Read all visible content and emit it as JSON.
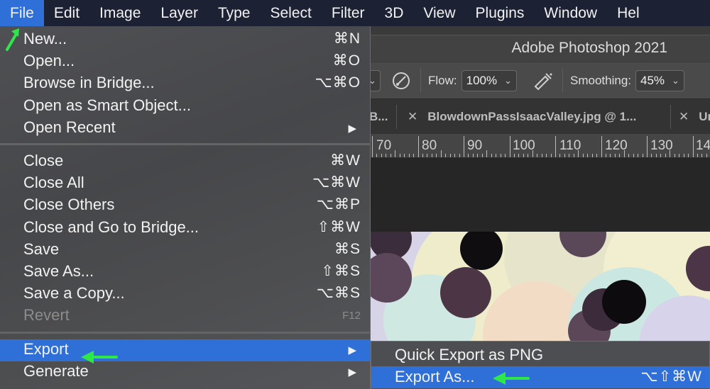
{
  "menubar": {
    "items": [
      "File",
      "Edit",
      "Image",
      "Layer",
      "Type",
      "Select",
      "Filter",
      "3D",
      "View",
      "Plugins",
      "Window",
      "Hel"
    ],
    "active_index": 0
  },
  "window": {
    "title": "Adobe Photoshop 2021"
  },
  "options_bar": {
    "flow_label": "Flow:",
    "flow_value": "100%",
    "smoothing_label": "Smoothing:",
    "smoothing_value": "45%",
    "icons": [
      "airbrush-icon",
      "pressure-icon"
    ]
  },
  "tabs": [
    {
      "title": "B..."
    },
    {
      "title": "BlowdownPassIsaacValley.jpg @ 1..."
    },
    {
      "title": "Ur"
    }
  ],
  "ruler": {
    "labels": [
      "70",
      "80",
      "90",
      "100",
      "110",
      "120",
      "130",
      "14"
    ]
  },
  "file_menu": {
    "groups": [
      [
        {
          "label": "New...",
          "shortcut": "⌘N"
        },
        {
          "label": "Open...",
          "shortcut": "⌘O"
        },
        {
          "label": "Browse in Bridge...",
          "shortcut": "⌥⌘O"
        },
        {
          "label": "Open as Smart Object...",
          "shortcut": ""
        },
        {
          "label": "Open Recent",
          "shortcut": "",
          "submenu": true
        }
      ],
      [
        {
          "label": "Close",
          "shortcut": "⌘W"
        },
        {
          "label": "Close All",
          "shortcut": "⌥⌘W"
        },
        {
          "label": "Close Others",
          "shortcut": "⌥⌘P"
        },
        {
          "label": "Close and Go to Bridge...",
          "shortcut": "⇧⌘W"
        },
        {
          "label": "Save",
          "shortcut": "⌘S"
        },
        {
          "label": "Save As...",
          "shortcut": "⇧⌘S"
        },
        {
          "label": "Save a Copy...",
          "shortcut": "⌥⌘S"
        },
        {
          "label": "Revert",
          "shortcut": "F12",
          "disabled": true
        }
      ],
      [
        {
          "label": "Export",
          "shortcut": "",
          "submenu": true,
          "highlighted": true
        },
        {
          "label": "Generate",
          "shortcut": "",
          "submenu": true
        }
      ]
    ]
  },
  "export_submenu": [
    {
      "label": "Quick Export as PNG",
      "shortcut": ""
    },
    {
      "label": "Export As...",
      "shortcut": "⌥⇧⌘W",
      "highlighted": true
    }
  ],
  "colors": {
    "menubar_bg": "#1c2233",
    "highlight": "#2f6fd8",
    "annotation_arrow": "#2ee84a"
  }
}
